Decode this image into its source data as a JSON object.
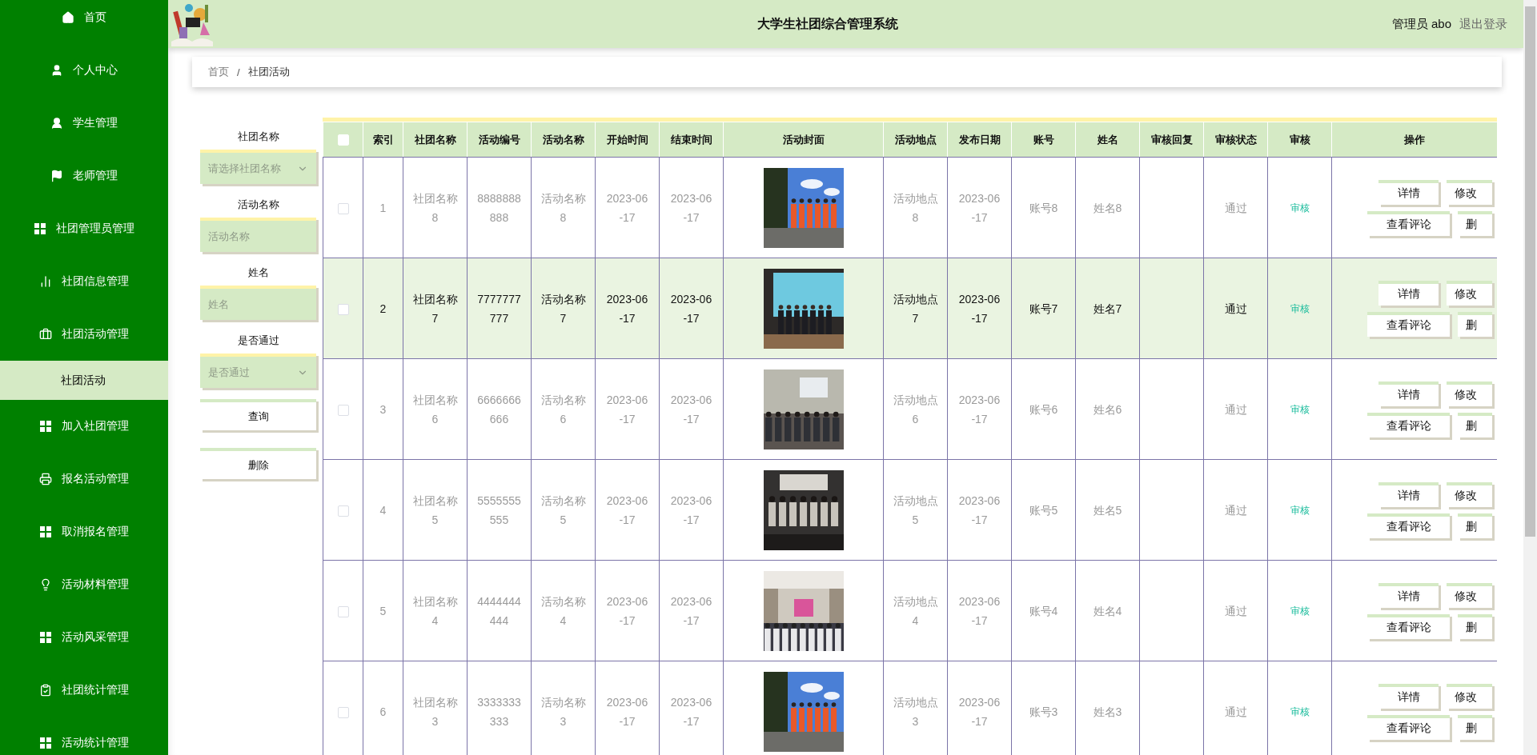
{
  "header": {
    "title": "大学生社团综合管理系统",
    "user": "管理员 abo",
    "logout": "退出登录"
  },
  "sidebar": {
    "items": [
      {
        "label": "首页",
        "selected": false
      },
      {
        "label": "个人中心",
        "selected": false
      },
      {
        "label": "学生管理",
        "selected": false
      },
      {
        "label": "老师管理",
        "selected": false
      },
      {
        "label": "社团管理员管理",
        "selected": false
      },
      {
        "label": "社团信息管理",
        "selected": false
      },
      {
        "label": "社团活动管理",
        "selected": false,
        "expanded": true,
        "children": [
          {
            "label": "社团活动",
            "selected": true
          }
        ]
      },
      {
        "label": "加入社团管理",
        "selected": false
      },
      {
        "label": "报名活动管理",
        "selected": false
      },
      {
        "label": "取消报名管理",
        "selected": false
      },
      {
        "label": "活动材料管理",
        "selected": false
      },
      {
        "label": "活动风采管理",
        "selected": false
      },
      {
        "label": "社团统计管理",
        "selected": false
      },
      {
        "label": "活动统计管理",
        "selected": false
      }
    ]
  },
  "breadcrumb": {
    "items": [
      "首页",
      "社团活动"
    ],
    "separator": "/"
  },
  "filters": [
    {
      "kind": "select",
      "label": "社团名称",
      "placeholder": "请选择社团名称"
    },
    {
      "kind": "input",
      "label": "活动名称",
      "placeholder": "活动名称"
    },
    {
      "kind": "input",
      "label": "姓名",
      "placeholder": "姓名"
    },
    {
      "kind": "select",
      "label": "是否通过",
      "placeholder": "是否通过"
    }
  ],
  "filter_buttons": [
    "查询",
    "删除"
  ],
  "table": {
    "select_all_checked": false,
    "columns": [
      "索引",
      "社团名称",
      "活动编号",
      "活动名称",
      "开始时间",
      "结束时间",
      "活动封面",
      "活动地点",
      "发布日期",
      "账号",
      "姓名",
      "审核回复",
      "审核状态",
      "审核",
      "操作"
    ],
    "rows": [
      {
        "checked": false,
        "highlighted": false,
        "index": "1",
        "club": "社团名称8",
        "activity_no": "8888888888",
        "activity_name": "活动名称8",
        "start": "2023-06-17",
        "end": "2023-06-17",
        "place": "活动地点8",
        "published": "2023-06-17",
        "account": "账号8",
        "name": "姓名8",
        "status": "通过",
        "review": "审核",
        "actions": [
          "详情",
          "修改",
          "查看评论",
          "删"
        ]
      },
      {
        "checked": false,
        "highlighted": true,
        "index": "2",
        "club": "社团名称7",
        "activity_no": "7777777777",
        "activity_name": "活动名称7",
        "start": "2023-06-17",
        "end": "2023-06-17",
        "place": "活动地点7",
        "published": "2023-06-17",
        "account": "账号7",
        "name": "姓名7",
        "status": "通过",
        "review": "审核",
        "actions": [
          "详情",
          "修改",
          "查看评论",
          "删"
        ]
      },
      {
        "checked": false,
        "highlighted": false,
        "index": "3",
        "club": "社团名称6",
        "activity_no": "6666666666",
        "activity_name": "活动名称6",
        "start": "2023-06-17",
        "end": "2023-06-17",
        "place": "活动地点6",
        "published": "2023-06-17",
        "account": "账号6",
        "name": "姓名6",
        "status": "通过",
        "review": "审核",
        "actions": [
          "详情",
          "修改",
          "查看评论",
          "删"
        ]
      },
      {
        "checked": false,
        "highlighted": false,
        "index": "4",
        "club": "社团名称5",
        "activity_no": "5555555555",
        "activity_name": "活动名称5",
        "start": "2023-06-17",
        "end": "2023-06-17",
        "place": "活动地点5",
        "published": "2023-06-17",
        "account": "账号5",
        "name": "姓名5",
        "status": "通过",
        "review": "审核",
        "actions": [
          "详情",
          "修改",
          "查看评论",
          "删"
        ]
      },
      {
        "checked": false,
        "highlighted": false,
        "index": "5",
        "club": "社团名称4",
        "activity_no": "4444444444",
        "activity_name": "活动名称4",
        "start": "2023-06-17",
        "end": "2023-06-17",
        "place": "活动地点4",
        "published": "2023-06-17",
        "account": "账号4",
        "name": "姓名4",
        "status": "通过",
        "review": "审核",
        "actions": [
          "详情",
          "修改",
          "查看评论",
          "删"
        ]
      },
      {
        "checked": false,
        "highlighted": false,
        "index": "6",
        "club": "社团名称3",
        "activity_no": "3333333333",
        "activity_name": "活动名称3",
        "start": "2023-06-17",
        "end": "2023-06-17",
        "place": "活动地点3",
        "published": "2023-06-17",
        "account": "账号3",
        "name": "姓名3",
        "status": "通过",
        "review": "审核",
        "actions": [
          "详情",
          "修改",
          "查看评论",
          "删"
        ]
      }
    ]
  }
}
